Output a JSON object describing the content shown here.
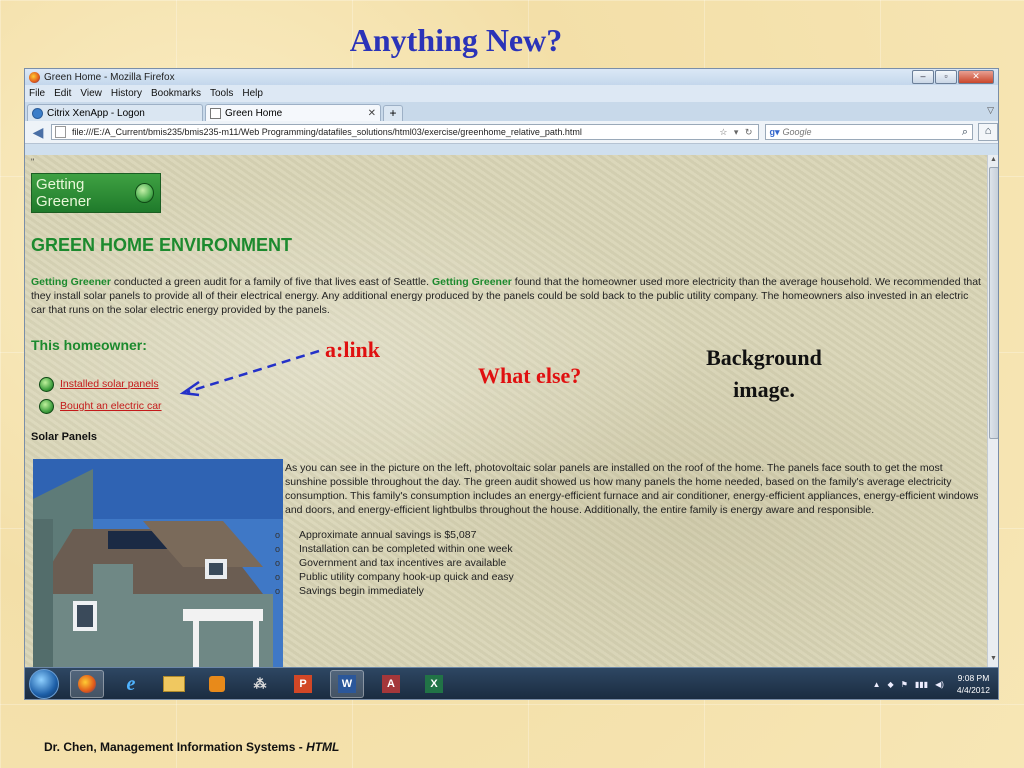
{
  "slide": {
    "title": "Anything New?",
    "footer_prefix": "Dr. Chen, Management Information Systems - ",
    "footer_em": "HTML"
  },
  "annotations": {
    "alink": "a:link",
    "what_else": "What else?",
    "background_image": "Background image."
  },
  "browser": {
    "window_title": "Green Home - Mozilla Firefox",
    "menu": [
      "File",
      "Edit",
      "View",
      "History",
      "Bookmarks",
      "Tools",
      "Help"
    ],
    "tabs": [
      {
        "label": "Citrix XenApp - Logon"
      },
      {
        "label": "Green Home"
      }
    ],
    "url": "file:///E:/A_Current/bmis235/bmis235-m11/Web Programming/datafiles_solutions/html03/exercise/greenhome_relative_path.html",
    "search_placeholder": "Google",
    "search_engine_icon": "google-icon"
  },
  "page": {
    "small_mark": "\"",
    "logo_text": "Getting Greener",
    "heading": "GREEN HOME ENVIRONMENT",
    "para_brand1": "Getting Greener",
    "para_text1": " conducted a green audit for a family of five that lives east of Seattle. ",
    "para_brand2": "Getting Greener",
    "para_text2": " found that the homeowner used more electricity than the average household. We recommended that they install solar panels to provide all of their electrical energy. Any additional energy produced by the panels could be sold back to the public utility company. The homeowners also invested in an electric car that runs on the solar electric energy provided by the panels.",
    "subheading": "This homeowner:",
    "links": [
      "Installed solar panels",
      "Bought an electric car"
    ],
    "section_title": "Solar Panels",
    "description": "As you can see in the picture on the left, photovoltaic solar panels are installed on the roof of the home. The panels face south to get the most sunshine possible throughout the day. The green audit showed us how many panels the home needed, based on the family's average electricity consumption. This family's consumption includes an energy-efficient furnace and air conditioner, energy-efficient appliances, energy-efficient windows and doors, and energy-efficient lightbulbs throughout the house. Additionally, the entire family is energy aware and responsible.",
    "benefits": [
      "Approximate annual savings is $5,087",
      "Installation can be completed within one week",
      "Government and tax incentives are available",
      "Public utility company hook-up quick and easy",
      "Savings begin immediately"
    ]
  },
  "taskbar": {
    "time": "9:08 PM",
    "date": "4/4/2012"
  },
  "colors": {
    "slide_title": "#2b33b8",
    "annotation_red": "#e01010",
    "page_green": "#1c8a2e",
    "link_red": "#c41a1a"
  }
}
